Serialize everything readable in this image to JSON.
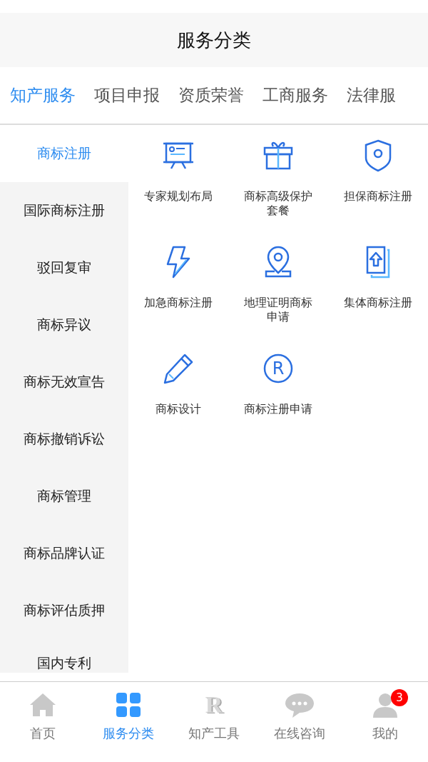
{
  "header": {
    "title": "服务分类"
  },
  "tabs": [
    {
      "label": "知产服务",
      "selected": true
    },
    {
      "label": "项目申报",
      "selected": false
    },
    {
      "label": "资质荣誉",
      "selected": false
    },
    {
      "label": "工商服务",
      "selected": false
    },
    {
      "label": "法律服",
      "selected": false
    }
  ],
  "sidebar": {
    "items": [
      {
        "label": "商标注册",
        "selected": true
      },
      {
        "label": "国际商标注册",
        "selected": false
      },
      {
        "label": "驳回复审",
        "selected": false
      },
      {
        "label": "商标异议",
        "selected": false
      },
      {
        "label": "商标无效宣告",
        "selected": false
      },
      {
        "label": "商标撤销诉讼",
        "selected": false
      },
      {
        "label": "商标管理",
        "selected": false
      },
      {
        "label": "商标品牌认证",
        "selected": false
      },
      {
        "label": "商标评估质押",
        "selected": false
      },
      {
        "label": "国内专利",
        "selected": false
      }
    ]
  },
  "services": [
    {
      "label": "专家规划布局",
      "kind": "board"
    },
    {
      "label": "商标高级保护套餐",
      "kind": "gift"
    },
    {
      "label": "担保商标注册",
      "kind": "shield"
    },
    {
      "label": "加急商标注册",
      "kind": "bolt"
    },
    {
      "label": "地理证明商标申请",
      "kind": "pin"
    },
    {
      "label": "集体商标注册",
      "kind": "upload"
    },
    {
      "label": "商标设计",
      "kind": "pencil"
    },
    {
      "label": "商标注册申请",
      "kind": "registered",
      "icon_text": "R"
    }
  ],
  "tab_bar": [
    {
      "label": "首页",
      "kind": "home",
      "selected": false
    },
    {
      "label": "服务分类",
      "kind": "grid",
      "selected": true
    },
    {
      "label": "知产工具",
      "kind": "letter",
      "icon_text": "R",
      "selected": false
    },
    {
      "label": "在线咨询",
      "kind": "chat",
      "selected": false
    },
    {
      "label": "我的",
      "kind": "user",
      "badge": "3",
      "selected": false
    }
  ]
}
